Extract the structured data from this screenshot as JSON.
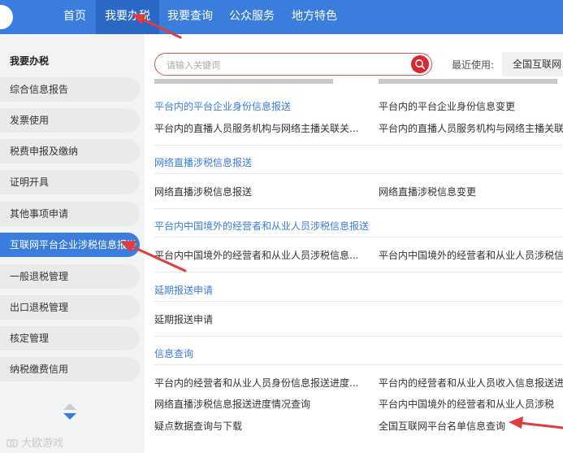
{
  "nav": {
    "items": [
      {
        "label": "首页",
        "active": false
      },
      {
        "label": "我要办税",
        "active": true
      },
      {
        "label": "我要查询",
        "active": false
      },
      {
        "label": "公众服务",
        "active": false
      },
      {
        "label": "地方特色",
        "active": false
      }
    ]
  },
  "sidebar": {
    "title": "我要办税",
    "items": [
      {
        "label": "综合信息报告",
        "active": false
      },
      {
        "label": "发票使用",
        "active": false
      },
      {
        "label": "税费申报及缴纳",
        "active": false
      },
      {
        "label": "证明开具",
        "active": false
      },
      {
        "label": "其他事项申请",
        "active": false
      },
      {
        "label": "互联网平台企业涉税信息报送",
        "active": true
      },
      {
        "label": "一般退税管理",
        "active": false
      },
      {
        "label": "出口退税管理",
        "active": false
      },
      {
        "label": "核定管理",
        "active": false
      },
      {
        "label": "纳税缴费信用",
        "active": false
      }
    ]
  },
  "search": {
    "placeholder": "请输入关键词",
    "value": ""
  },
  "recent": {
    "label": "最近使用:",
    "chip": "全国互联网"
  },
  "sections": [
    {
      "title": "平台内的平台企业身份信息报送",
      "links": [
        "平台内的直播人员服务机构与网络主播关联关...",
        "平台内的直播人员服务机构与网络主播关联关"
      ]
    },
    {
      "title": "网络直播涉税信息报送",
      "links": [
        "网络直播涉税信息报送",
        "网络直播涉税信息变更"
      ]
    },
    {
      "title": "平台内中国境外的经营者和从业人员涉税信息报送",
      "links": [
        "平台内中国境外的经营者和从业人员涉税信息...",
        "平台内中国境外的经营者和从业人员涉税信"
      ]
    },
    {
      "title": "延期报送申请",
      "links": [
        "延期报送申请"
      ]
    },
    {
      "title": "信息查询",
      "links": [
        "平台内的经营者和从业人员身份信息报送进度...",
        "平台内的经营者和从业人员收入信息报送进",
        "网络直播涉税信息报送进度情况查询",
        "平台内中国境外的经营者和从业人员涉税",
        "疑点数据查询与下载",
        "全国互联网平台名单信息查询"
      ]
    }
  ],
  "right_top_link": "平台内的平台企业身份信息变更",
  "watermark": "大欧游戏",
  "colors": {
    "primary": "#3b7ddd",
    "nav_active": "#2b67c4",
    "search_red": "#d9262f",
    "arrow_red": "#e03c3c"
  }
}
